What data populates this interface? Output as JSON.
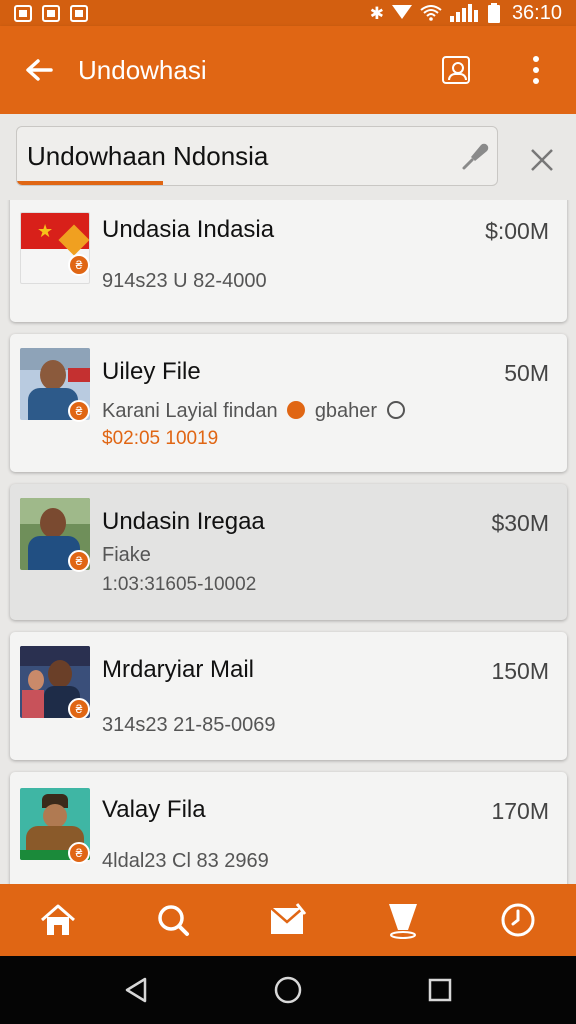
{
  "status_bar": {
    "time": "36:10",
    "icons": [
      "gallery-icon",
      "sim-icon",
      "photo-icon",
      "bluetooth-icon",
      "signal-icon",
      "wifi-icon",
      "battery-icon"
    ]
  },
  "app_bar": {
    "title": "Undowhasi",
    "back_icon": "arrow-left-icon",
    "actions": [
      "contact-card-icon",
      "overflow-menu-icon"
    ]
  },
  "search": {
    "value": "Undowhaan Ndonsia",
    "placeholder": "",
    "mic_icon": "mic-icon",
    "clear_icon": "close-icon"
  },
  "results": [
    {
      "name": "Undasia Indasia",
      "size": "$:00M",
      "line2": "914s23 U 82-4000"
    },
    {
      "name": "Uiley File",
      "size": "50M",
      "line2": "Karani Layial findan",
      "line2_after": "gbaher",
      "price": "$02:05 10019"
    },
    {
      "name": "Undasin Iregaa",
      "size": "$30M",
      "line2": "Fiake",
      "line3": "1:03:31605-10002"
    },
    {
      "name": "Mrdaryiar Mail",
      "size": "150M",
      "line2": "314s23 21-85-0069"
    },
    {
      "name": "Valay Fila",
      "size": "170M",
      "line2": "4ldal23 Cl 83 2969"
    }
  ],
  "bottom_nav": [
    "home-icon",
    "search-icon",
    "mail-icon",
    "cup-icon",
    "clock-icon"
  ],
  "system_nav": [
    "back-triangle-icon",
    "home-circle-icon",
    "recents-square-icon"
  ],
  "colors": {
    "primary": "#e06614",
    "status": "#d35f10",
    "background": "#e9e8e6",
    "card": "#f4f4f3"
  }
}
